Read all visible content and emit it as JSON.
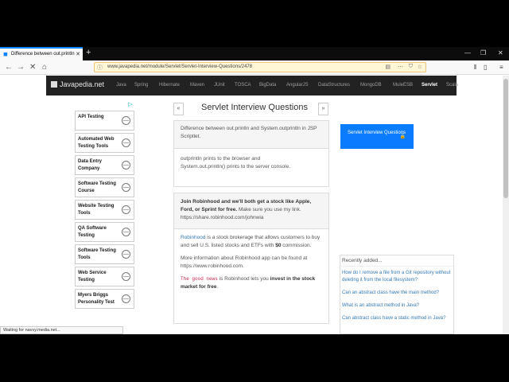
{
  "browser": {
    "tab_title": "Difference between out.println",
    "new_tab": "+",
    "url": "www.javapedia.net/module/Servlet/Servlet-Interview-Questions/2478",
    "status": "Waiting for navvy.media.net..."
  },
  "site": {
    "logo": "Javapedia.net",
    "nav": [
      "Java",
      "Spring",
      "Hibernate",
      "Maven",
      "JUnit",
      "TOSCA",
      "BigData",
      "AngularJS",
      "DataStructures",
      "MongoDB",
      "MuleESB",
      "Servlet",
      "Scala"
    ]
  },
  "ads": {
    "adchoices": "▷",
    "items": [
      {
        "label": "API Testing"
      },
      {
        "label": "Automated Web Testing Tools"
      },
      {
        "label": "Data Entry Company"
      },
      {
        "label": "Software Testing Course"
      },
      {
        "label": "Website Testing Tools"
      },
      {
        "label": "QA Software Testing"
      },
      {
        "label": "Software Testing Tools"
      },
      {
        "label": "Web Service Testing"
      },
      {
        "label": "Myers Briggs Personality Test"
      }
    ],
    "button_glyph": "—"
  },
  "main": {
    "prev": "«",
    "next": "»",
    "title": "Servlet Interview Questions",
    "question": "Difference between out.println and System.outprintln in JSP Scriptlet.",
    "answer_1": "outprintln prints to the browser and",
    "answer_2": "System.out.println() prints to the server console.",
    "promo_bold": "Join Robinhood and we'll both get a stock like Apple, Ford, or Sprint for free.",
    "promo_rest": " Make sure you use my link. https://share.robinhood.com/johnwia",
    "p1_link": "Robinhood",
    "p1_text": " is a stock brokerage that allows customers to buy and sell U.S. listed stocks and ETFs with ",
    "p1_bold": "$0",
    "p1_end": " commission.",
    "p2": "More information about Robinhood app can be found at https://www.robinhood.com.",
    "p3_code": "The good news",
    "p3_text": " is Robinhood lets you ",
    "p3_bold": "invest in the stock market for free",
    "p3_end": "."
  },
  "right": {
    "button_label": "Servlet Interview Questions",
    "recent_title": "Recently added...",
    "recent": [
      "How do I remove a file from a Git repository without deleting it from the local filesystem?",
      "Can an abstract class have the main method?",
      "What is an abstract method in Java?",
      "Can abstract class have a static method in Java?"
    ]
  },
  "colors": {
    "accent": "#0a7cff",
    "navbar_bg": "#222222",
    "urlbar_bg": "#fff7d6"
  }
}
